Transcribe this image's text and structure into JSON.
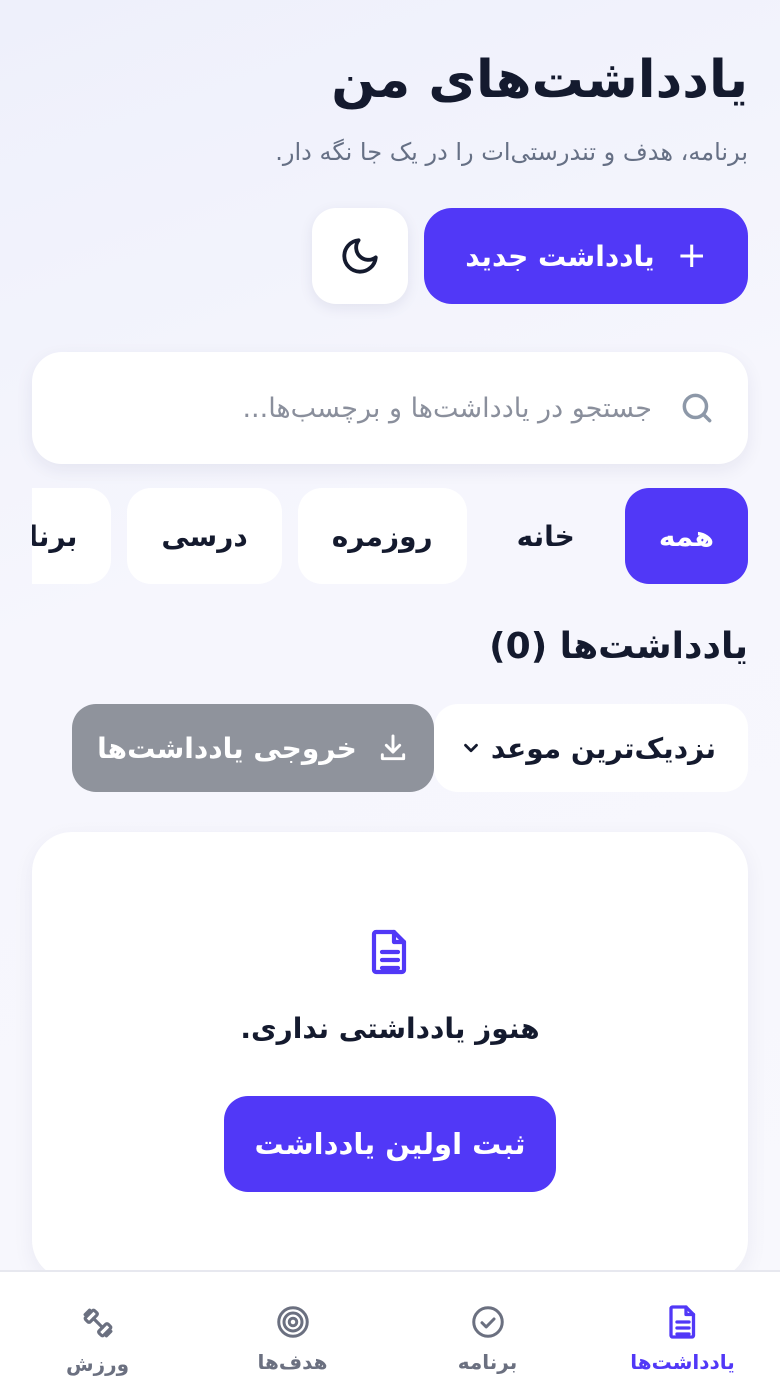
{
  "header": {
    "title": "یادداشت‌های من",
    "subtitle": "برنامه، هدف و تندرستی‌ات را در یک جا نگه دار."
  },
  "actions": {
    "new_note_label": "یادداشت جدید",
    "theme_icon": "moon-icon"
  },
  "search": {
    "placeholder": "جستجو در یادداشت‌ها و برچسب‌ها..."
  },
  "filters": [
    {
      "label": "همه",
      "active": true
    },
    {
      "label": "خانه",
      "active": false
    },
    {
      "label": "روزمره",
      "active": false
    },
    {
      "label": "درسی",
      "active": false
    },
    {
      "label": "برنامه‌ریزی",
      "active": false
    }
  ],
  "list": {
    "title": "یادداشت‌ها (0)",
    "sort_value": "نزدیک‌ترین موعد",
    "export_label": "خروجی یادداشت‌ها"
  },
  "empty_state": {
    "message": "هنوز یادداشتی نداری.",
    "cta_label": "ثبت اولین یادداشت"
  },
  "bottom_nav": [
    {
      "label": "یادداشت‌ها",
      "icon": "note-icon",
      "active": true
    },
    {
      "label": "برنامه",
      "icon": "check-circle-icon",
      "active": false
    },
    {
      "label": "هدف‌ها",
      "icon": "target-icon",
      "active": false
    },
    {
      "label": "ورزش",
      "icon": "dumbbell-icon",
      "active": false
    }
  ],
  "colors": {
    "accent": "#5138f7",
    "export_disabled": "#8f939c",
    "text": "#141a2e",
    "muted": "#667085"
  }
}
